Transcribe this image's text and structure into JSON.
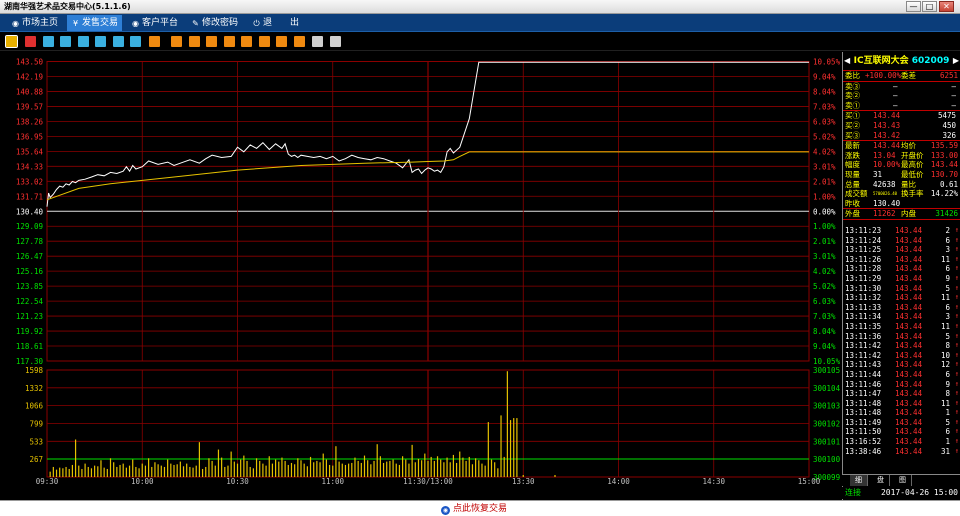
{
  "window": {
    "title": "湖南华强艺术品交易中心(5.1.1.6)",
    "btn_min": "—",
    "btn_max": "□",
    "btn_close": "✕"
  },
  "menu": [
    {
      "label": "市场主页",
      "icon": "globe-icon",
      "glyph": "◉",
      "active": false
    },
    {
      "label": "发售交易",
      "icon": "coin-icon",
      "glyph": "¥",
      "active": true
    },
    {
      "label": "客户平台",
      "icon": "globe-icon",
      "glyph": "◉",
      "active": false
    },
    {
      "label": "修改密码",
      "icon": "key-icon",
      "glyph": "✎",
      "active": false
    },
    {
      "label": "退　　出",
      "icon": "exit-icon",
      "glyph": "⏻",
      "active": false
    }
  ],
  "toolbar_icons": [
    {
      "name": "timeshare-chart-icon",
      "color": "#e8b000"
    },
    {
      "name": "kline-chart-icon",
      "color": "#e03030"
    },
    {
      "name": "candle-chart-icon",
      "color": "#3ab0e0"
    },
    {
      "name": "report-icon",
      "color": "#3ab0e0"
    },
    {
      "name": "list-icon",
      "color": "#3ab0e0"
    },
    {
      "name": "grid-icon",
      "color": "#3ab0e0"
    },
    {
      "name": "table-icon",
      "color": "#3ab0e0"
    },
    {
      "name": "info-icon",
      "color": "#3ab0e0"
    },
    {
      "name": "f1-icon",
      "color": "#f08a10"
    },
    {
      "name": "f2-icon",
      "color": "#f08a10"
    },
    {
      "name": "f3-icon",
      "color": "#f08a10"
    },
    {
      "name": "f4-icon",
      "color": "#f08a10"
    },
    {
      "name": "f5-icon",
      "color": "#f08a10"
    },
    {
      "name": "f6-icon",
      "color": "#f08a10"
    },
    {
      "name": "f7-icon",
      "color": "#f08a10"
    },
    {
      "name": "f8-icon",
      "color": "#f08a10"
    },
    {
      "name": "f9-icon",
      "color": "#f08a10"
    },
    {
      "name": "pen-icon",
      "color": "#d0d0d0"
    },
    {
      "name": "gear-icon",
      "color": "#d0d0d0"
    }
  ],
  "chart_data": {
    "type": "line",
    "prev_close": 130.4,
    "price_axis": {
      "min": 117.3,
      "max": 143.5,
      "labels": [
        "143.50",
        "142.19",
        "140.88",
        "139.57",
        "138.26",
        "136.95",
        "135.64",
        "134.33",
        "133.02",
        "131.71",
        "130.40",
        "129.09",
        "127.78",
        "126.47",
        "125.16",
        "123.85",
        "122.54",
        "121.23",
        "119.92",
        "118.61",
        "117.30"
      ]
    },
    "pct_labels": [
      "10.05%",
      "9.04%",
      "8.04%",
      "7.03%",
      "6.03%",
      "5.02%",
      "4.02%",
      "3.01%",
      "2.01%",
      "1.00%",
      "0.00%",
      "1.00%",
      "2.01%",
      "3.01%",
      "4.02%",
      "5.02%",
      "6.03%",
      "7.03%",
      "8.04%",
      "9.04%",
      "10.05%"
    ],
    "volume_axis": {
      "max": 1598,
      "labels": [
        "1598",
        "1332",
        "1066",
        "799",
        "533",
        "267"
      ]
    },
    "volume_right_labels": [
      "300105",
      "300104",
      "300103",
      "300102",
      "300101",
      "300100",
      "300099"
    ],
    "time_labels": [
      "09:30",
      "10:00",
      "10:30",
      "11:00",
      "11:30/13:00",
      "13:30",
      "14:00",
      "14:30",
      "15:00"
    ],
    "series": [
      {
        "name": "",
        "x": [
          0,
          0.5,
          1,
          2,
          3,
          4,
          5,
          6,
          7,
          8,
          9,
          10,
          12,
          14,
          16,
          18,
          20,
          22,
          24,
          25,
          26,
          27,
          28,
          30,
          32,
          35,
          38,
          40,
          42,
          45,
          48,
          50,
          52,
          55,
          58,
          60,
          62,
          64,
          66,
          68,
          70,
          72,
          74,
          75,
          76,
          77,
          78,
          79,
          80,
          82,
          84,
          86,
          88,
          90,
          92,
          94,
          96,
          98,
          100,
          102,
          104,
          106,
          108,
          110,
          112,
          114,
          115,
          116,
          117,
          118,
          119,
          120,
          121,
          122,
          123,
          124,
          125,
          126,
          127,
          128,
          130,
          133,
          136,
          240
        ],
        "y": [
          130.8,
          132.0,
          131.6,
          131.9,
          132.3,
          132.6,
          132.5,
          132.8,
          132.7,
          133.0,
          132.9,
          133.1,
          133.2,
          133.4,
          133.6,
          133.5,
          133.8,
          133.7,
          133.9,
          134.3,
          133.9,
          134.4,
          134.1,
          134.3,
          134.8,
          134.5,
          134.7,
          134.4,
          134.6,
          134.9,
          134.6,
          135.0,
          135.3,
          135.1,
          135.2,
          136.0,
          135.6,
          136.2,
          135.9,
          136.4,
          135.8,
          136.3,
          135.9,
          136.3,
          135.4,
          135.2,
          135.3,
          135.1,
          135.3,
          135.2,
          135.1,
          135.2,
          135.0,
          135.2,
          134.8,
          135.0,
          135.3,
          135.1,
          135.0,
          134.9,
          135.1,
          135.0,
          134.8,
          134.6,
          134.2,
          134.9,
          133.8,
          134.0,
          134.1,
          133.7,
          134.0,
          134.2,
          134.1,
          133.9,
          134.0,
          133.8,
          134.3,
          135.6,
          135.9,
          135.5,
          136.0,
          138.5,
          143.44,
          143.44
        ]
      },
      {
        "name": "",
        "x": [
          0,
          10,
          20,
          40,
          60,
          80,
          100,
          115,
          120,
          125,
          128,
          130,
          133,
          240
        ],
        "y": [
          131.4,
          132.4,
          132.8,
          133.4,
          134.0,
          134.4,
          134.6,
          134.7,
          134.75,
          134.8,
          134.9,
          135.2,
          135.59,
          135.59
        ]
      }
    ],
    "volume": {
      "x": [
        1,
        2,
        3,
        4,
        5,
        6,
        7,
        8,
        9,
        10,
        11,
        12,
        13,
        14,
        15,
        16,
        17,
        18,
        19,
        20,
        21,
        22,
        23,
        24,
        25,
        26,
        27,
        28,
        29,
        30,
        31,
        32,
        33,
        34,
        35,
        36,
        37,
        38,
        39,
        40,
        41,
        42,
        43,
        44,
        45,
        46,
        47,
        48,
        49,
        50,
        51,
        52,
        53,
        54,
        55,
        56,
        57,
        58,
        59,
        60,
        61,
        62,
        63,
        64,
        65,
        66,
        67,
        68,
        69,
        70,
        71,
        72,
        73,
        74,
        75,
        76,
        77,
        78,
        79,
        80,
        81,
        82,
        83,
        84,
        85,
        86,
        87,
        88,
        89,
        90,
        91,
        92,
        93,
        94,
        95,
        96,
        97,
        98,
        99,
        100,
        101,
        102,
        103,
        104,
        105,
        106,
        107,
        108,
        109,
        110,
        111,
        112,
        113,
        114,
        115,
        116,
        117,
        118,
        119,
        120,
        121,
        122,
        123,
        124,
        125,
        126,
        127,
        128,
        129,
        130,
        131,
        132,
        133,
        134,
        135,
        136,
        137,
        138,
        139,
        140,
        141,
        142,
        143,
        144,
        145,
        146,
        147,
        148,
        150,
        160
      ],
      "values": [
        80,
        150,
        110,
        140,
        130,
        150,
        120,
        180,
        560,
        170,
        120,
        200,
        150,
        130,
        170,
        160,
        250,
        140,
        120,
        280,
        220,
        150,
        180,
        200,
        140,
        170,
        260,
        150,
        130,
        200,
        170,
        280,
        150,
        220,
        190,
        170,
        150,
        260,
        200,
        180,
        190,
        230,
        160,
        200,
        150,
        140,
        170,
        520,
        120,
        150,
        280,
        240,
        170,
        410,
        290,
        150,
        170,
        380,
        230,
        200,
        260,
        320,
        240,
        150,
        130,
        280,
        240,
        200,
        170,
        310,
        200,
        260,
        230,
        290,
        240,
        180,
        210,
        190,
        280,
        250,
        200,
        160,
        300,
        220,
        240,
        220,
        350,
        260,
        180,
        170,
        460,
        230,
        200,
        180,
        200,
        210,
        290,
        240,
        210,
        320,
        250,
        190,
        240,
        490,
        310,
        210,
        230,
        240,
        260,
        200,
        180,
        310,
        260,
        200,
        480,
        220,
        270,
        250,
        350,
        240,
        300,
        240,
        310,
        260,
        220,
        290,
        220,
        330,
        210,
        380,
        290,
        240,
        300,
        190,
        280,
        250,
        200,
        170,
        820,
        260,
        220,
        130,
        920,
        300,
        1580,
        850,
        880,
        880,
        30,
        30
      ]
    }
  },
  "panel": {
    "stock_name": "IC互联网大会",
    "stock_code": "602009",
    "ratio_label": "委比",
    "ratio_value": "+100.00%",
    "diff_label": "委差",
    "diff_value": "6251",
    "sell": [
      {
        "label": "卖③",
        "price": "—",
        "vol": "—"
      },
      {
        "label": "卖②",
        "price": "—",
        "vol": "—"
      },
      {
        "label": "卖①",
        "price": "—",
        "vol": "—"
      }
    ],
    "buy": [
      {
        "label": "买①",
        "price": "143.44",
        "vol": "5475"
      },
      {
        "label": "买②",
        "price": "143.43",
        "vol": "450"
      },
      {
        "label": "买③",
        "price": "143.42",
        "vol": "326"
      }
    ],
    "stats": [
      {
        "l1": "最新",
        "v1": "143.44",
        "c1": "red",
        "l2": "均价",
        "v2": "135.59",
        "c2": "red"
      },
      {
        "l1": "涨跌",
        "v1": "13.04",
        "c1": "red",
        "l2": "开盘价",
        "v2": "133.00",
        "c2": "red"
      },
      {
        "l1": "幅度",
        "v1": "10.00%",
        "c1": "red",
        "l2": "最高价",
        "v2": "143.44",
        "c2": "red"
      },
      {
        "l1": "现量",
        "v1": "31",
        "c1": "wht",
        "l2": "最低价",
        "v2": "130.70",
        "c2": "red"
      },
      {
        "l1": "总量",
        "v1": "42638",
        "c1": "wht",
        "l2": "量比",
        "v2": "0.61",
        "c2": "wht"
      },
      {
        "l1": "成交额",
        "v1": "5700026.40",
        "c1": "yel",
        "l2": "换手率",
        "v2": "14.22%",
        "c2": "wht"
      },
      {
        "l1": "昨收",
        "v1": "130.40",
        "c1": "wht",
        "l2": "",
        "v2": "",
        "c2": "wht"
      }
    ],
    "outer_label": "外盘",
    "outer_value": "11262",
    "inner_label": "内盘",
    "inner_value": "31426",
    "ticks": [
      {
        "t": "13:11:23",
        "p": "143.44",
        "v": "2"
      },
      {
        "t": "13:11:24",
        "p": "143.44",
        "v": "6"
      },
      {
        "t": "13:11:25",
        "p": "143.44",
        "v": "3"
      },
      {
        "t": "13:11:26",
        "p": "143.44",
        "v": "11"
      },
      {
        "t": "13:11:28",
        "p": "143.44",
        "v": "6"
      },
      {
        "t": "13:11:29",
        "p": "143.44",
        "v": "9"
      },
      {
        "t": "13:11:30",
        "p": "143.44",
        "v": "5"
      },
      {
        "t": "13:11:32",
        "p": "143.44",
        "v": "11"
      },
      {
        "t": "13:11:33",
        "p": "143.44",
        "v": "6"
      },
      {
        "t": "13:11:34",
        "p": "143.44",
        "v": "3"
      },
      {
        "t": "13:11:35",
        "p": "143.44",
        "v": "11"
      },
      {
        "t": "13:11:36",
        "p": "143.44",
        "v": "5"
      },
      {
        "t": "13:11:42",
        "p": "143.44",
        "v": "8"
      },
      {
        "t": "13:11:42",
        "p": "143.44",
        "v": "10"
      },
      {
        "t": "13:11:43",
        "p": "143.44",
        "v": "12"
      },
      {
        "t": "13:11:44",
        "p": "143.44",
        "v": "6"
      },
      {
        "t": "13:11:46",
        "p": "143.44",
        "v": "9"
      },
      {
        "t": "13:11:47",
        "p": "143.44",
        "v": "8"
      },
      {
        "t": "13:11:48",
        "p": "143.44",
        "v": "11"
      },
      {
        "t": "13:11:48",
        "p": "143.44",
        "v": "1"
      },
      {
        "t": "13:11:49",
        "p": "143.44",
        "v": "5"
      },
      {
        "t": "13:11:50",
        "p": "143.44",
        "v": "6"
      },
      {
        "t": "13:16:52",
        "p": "143.44",
        "v": "1"
      },
      {
        "t": "13:38:46",
        "p": "143.44",
        "v": "31"
      }
    ],
    "tick_arrow": "↑",
    "tabs": [
      "细",
      "盘",
      "图"
    ],
    "connection": "连接",
    "datetime": "2017-04-26 15:00"
  },
  "bottom": {
    "restore_label": "点此恢复交易",
    "restore_icon": "eye-icon"
  },
  "colors": {
    "grid": "#8b0000",
    "price_line": "#ffffff",
    "avg_line": "#e6c200",
    "volume_bar": "#e6c200",
    "up": "#ff3030",
    "down": "#00e000"
  }
}
